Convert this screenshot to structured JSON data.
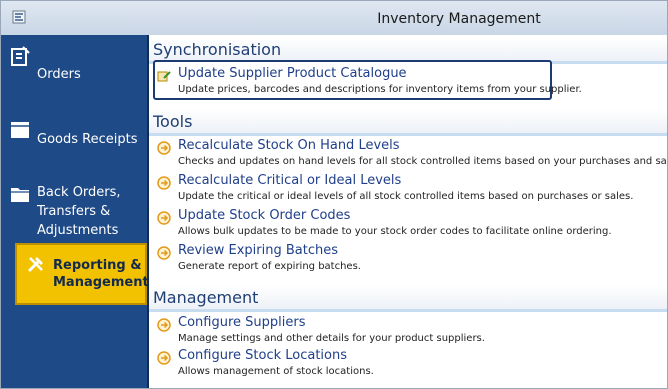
{
  "window": {
    "title": "Inventory Management"
  },
  "sidebar": {
    "items": [
      {
        "label": "Orders",
        "icon": "orders-icon"
      },
      {
        "label": "Goods Receipts",
        "icon": "box-icon"
      },
      {
        "label": "Back Orders, Transfers & Adjustments",
        "icon": "folder-icon"
      },
      {
        "label": "Reporting & Management",
        "icon": "tools-icon",
        "selected": true
      }
    ]
  },
  "sections": [
    {
      "title": "Synchronisation",
      "actions": [
        {
          "title": "Update Supplier Product Catalogue",
          "desc": "Update prices, barcodes and descriptions for inventory items from your supplier.",
          "icon": "edit-note-icon",
          "selected": true
        }
      ]
    },
    {
      "title": "Tools",
      "actions": [
        {
          "title": "Recalculate Stock On Hand Levels",
          "desc": "Checks and updates on hand levels for all stock controlled items based on your purchases and sales history.",
          "icon": "arrow-circle-icon"
        },
        {
          "title": "Recalculate Critical or Ideal Levels",
          "desc": "Update the critical or ideal levels of all stock controlled items based on purchases or sales.",
          "icon": "arrow-circle-icon"
        },
        {
          "title": "Update Stock Order Codes",
          "desc": "Allows bulk updates to be made to your stock order codes to facilitate online ordering.",
          "icon": "arrow-circle-icon"
        },
        {
          "title": "Review Expiring Batches",
          "desc": "Generate report of expiring batches.",
          "icon": "arrow-circle-icon"
        }
      ]
    },
    {
      "title": "Management",
      "actions": [
        {
          "title": "Configure Suppliers",
          "desc": "Manage settings and other details for your product suppliers.",
          "icon": "arrow-circle-icon"
        },
        {
          "title": "Configure Stock Locations",
          "desc": "Allows management of stock locations.",
          "icon": "arrow-circle-icon"
        }
      ]
    }
  ],
  "colors": {
    "sidebar": "#1e4a87",
    "selected": "#f2c200",
    "link": "#1f3f8a",
    "accent_icon": "#e39a1b"
  }
}
